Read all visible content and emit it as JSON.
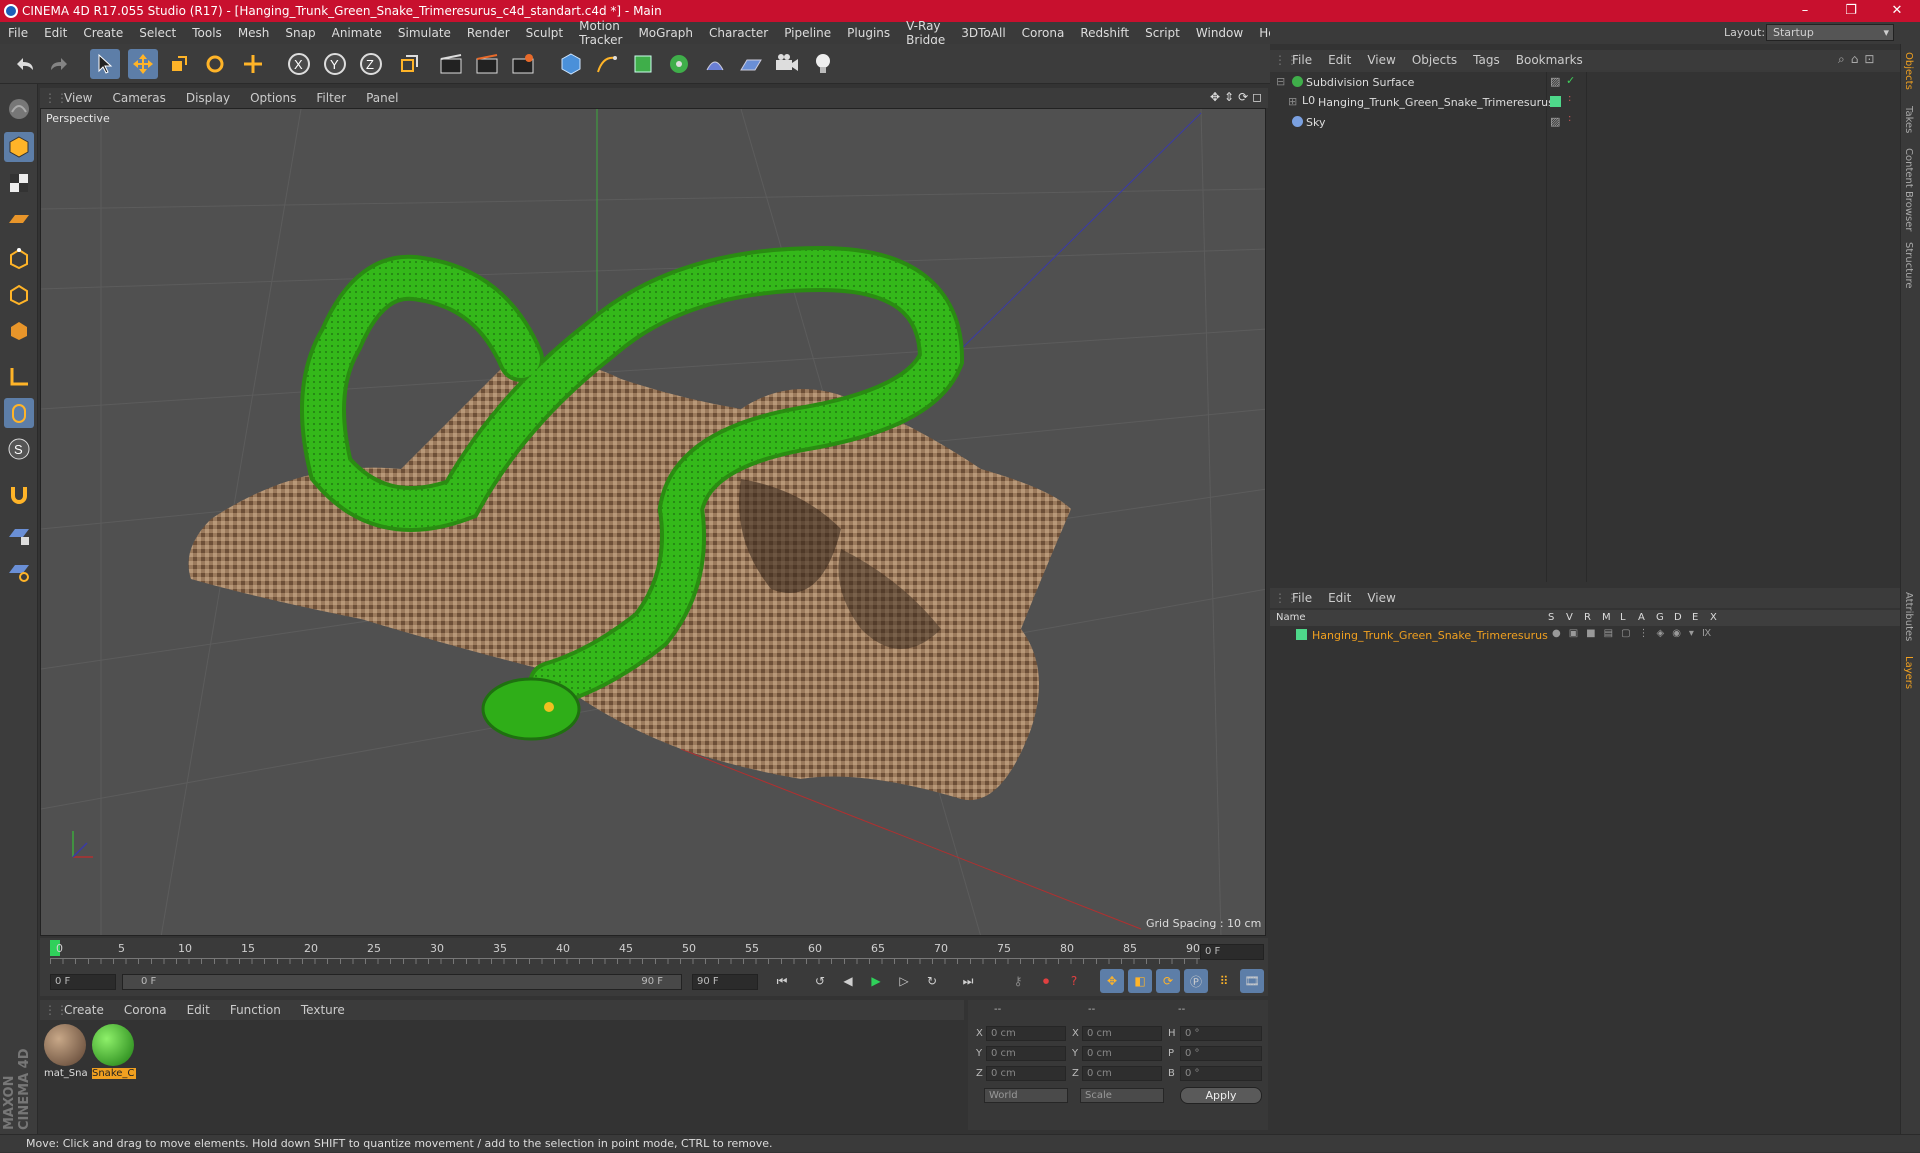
{
  "window": {
    "title": "CINEMA 4D R17.055 Studio (R17) - [Hanging_Trunk_Green_Snake_Trimeresurus_c4d_standart.c4d *] - Main",
    "controls": [
      "–",
      "❐",
      "✕"
    ]
  },
  "menu": [
    "File",
    "Edit",
    "Create",
    "Select",
    "Tools",
    "Mesh",
    "Snap",
    "Animate",
    "Simulate",
    "Render",
    "Sculpt",
    "Motion Tracker",
    "MoGraph",
    "Character",
    "Pipeline",
    "Plugins",
    "V-Ray Bridge",
    "3DToAll",
    "Corona",
    "Redshift",
    "Script",
    "Window",
    "Help"
  ],
  "layout": {
    "label": "Layout:",
    "value": "Startup"
  },
  "viewport": {
    "menu": [
      "View",
      "Cameras",
      "Display",
      "Options",
      "Filter",
      "Panel"
    ],
    "label": "Perspective",
    "grid_spacing": "Grid Spacing : 10 cm"
  },
  "timeline": {
    "ticks": [
      "0",
      "5",
      "10",
      "15",
      "20",
      "25",
      "30",
      "35",
      "40",
      "45",
      "50",
      "55",
      "60",
      "65",
      "70",
      "75",
      "80",
      "85",
      "90"
    ],
    "current_frame_field": "0 F",
    "start_field": "0 F",
    "range_start": "0 F",
    "range_end": "90 F",
    "end_field": "90 F"
  },
  "materials": {
    "menu": [
      "Create",
      "Corona",
      "Edit",
      "Function",
      "Texture"
    ],
    "items": [
      {
        "name": "mat_Sna",
        "selected": false
      },
      {
        "name": "Snake_C",
        "selected": true
      }
    ]
  },
  "coords": {
    "headers": [
      "--",
      "--",
      "--"
    ],
    "rows": [
      {
        "a": "X",
        "av": "0 cm",
        "b": "X",
        "bv": "0 cm",
        "c": "H",
        "cv": "0 °"
      },
      {
        "a": "Y",
        "av": "0 cm",
        "b": "Y",
        "bv": "0 cm",
        "c": "P",
        "cv": "0 °"
      },
      {
        "a": "Z",
        "av": "0 cm",
        "b": "Z",
        "bv": "0 cm",
        "c": "B",
        "cv": "0 °"
      }
    ],
    "mode": "World",
    "scale": "Scale",
    "apply": "Apply"
  },
  "objects": {
    "menu": [
      "File",
      "Edit",
      "View",
      "Objects",
      "Tags",
      "Bookmarks"
    ],
    "items": [
      {
        "name": "Subdivision Surface"
      },
      {
        "name": "Hanging_Trunk_Green_Snake_Trimeresurus"
      },
      {
        "name": "Sky"
      }
    ]
  },
  "layers": {
    "menu": [
      "File",
      "Edit",
      "View"
    ],
    "columns": [
      "Name",
      "S",
      "V",
      "R",
      "M",
      "L",
      "A",
      "G",
      "D",
      "E",
      "X"
    ],
    "items": [
      {
        "name": "Hanging_Trunk_Green_Snake_Trimeresurus"
      }
    ]
  },
  "side_tabs": [
    "Objects",
    "Takes",
    "Content Browser",
    "Structure",
    "Attributes",
    "Layers"
  ],
  "status": "Move: Click and drag to move elements. Hold down SHIFT to quantize movement / add to the selection in point mode, CTRL to remove.",
  "brand": "MAXON CINEMA 4D",
  "colors": {
    "title_bar": "#c8102e",
    "accent": "#5d7ea8",
    "snake_green": "#3cc41a",
    "layer_orange": "#f0a020"
  }
}
